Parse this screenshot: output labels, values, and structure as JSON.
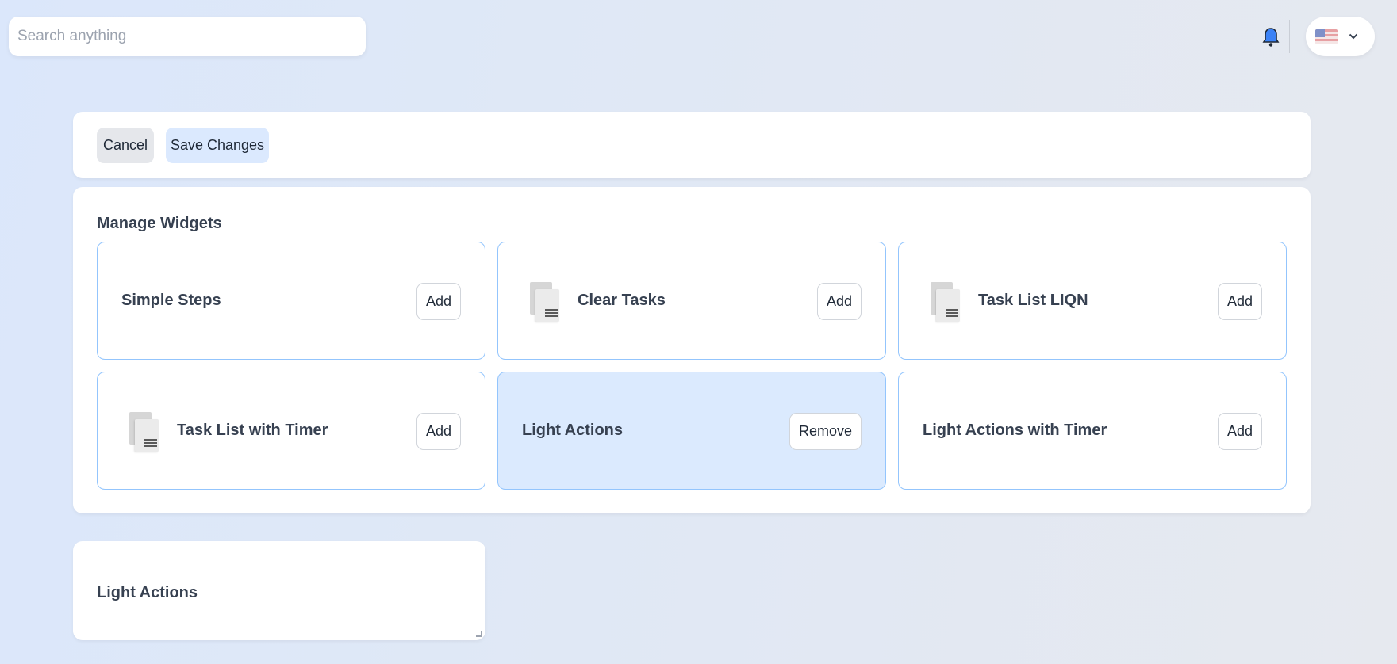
{
  "search": {
    "placeholder": "Search anything"
  },
  "header": {
    "language_icon": "us-flag-icon"
  },
  "toolbar": {
    "cancel_label": "Cancel",
    "save_label": "Save Changes"
  },
  "manage": {
    "heading": "Manage Widgets",
    "widgets": [
      {
        "title": "Simple Steps",
        "action": "Add",
        "icon": "none",
        "active": false
      },
      {
        "title": "Clear Tasks",
        "action": "Add",
        "icon": "document-icon",
        "active": false
      },
      {
        "title": "Task List LIQN",
        "action": "Add",
        "icon": "document-icon",
        "active": false
      },
      {
        "title": "Task List with Timer",
        "action": "Add",
        "icon": "document-icon",
        "active": false
      },
      {
        "title": "Light Actions",
        "action": "Remove",
        "icon": "none",
        "active": true
      },
      {
        "title": "Light Actions with Timer",
        "action": "Add",
        "icon": "none",
        "active": false
      }
    ]
  },
  "preview": {
    "title": "Light Actions"
  },
  "colors": {
    "accent_border": "#93c5fd",
    "active_card": "#dbeafe",
    "save_button": "#dbe9fe"
  }
}
